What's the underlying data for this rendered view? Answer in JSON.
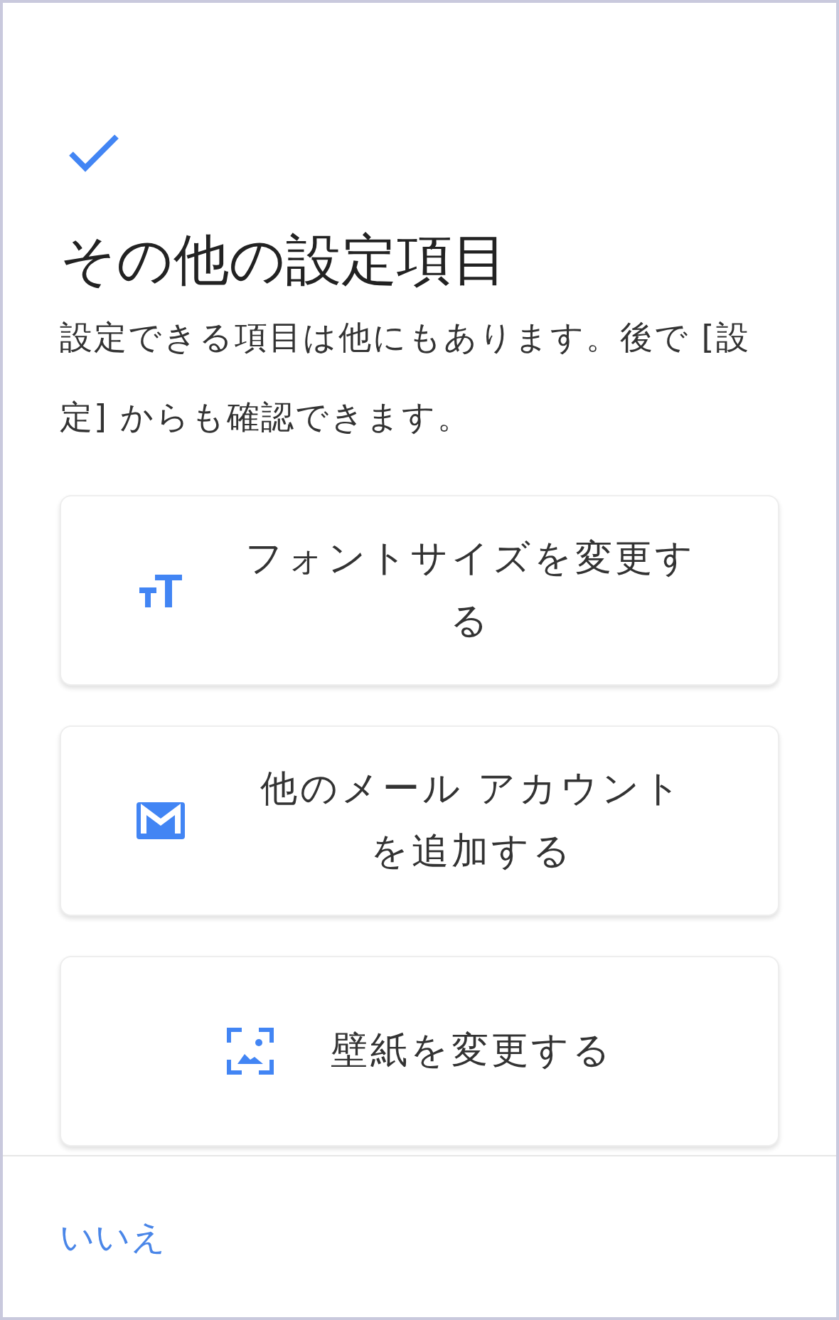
{
  "title": "その他の設定項目",
  "description": "設定できる項目は他にもあります。後で [設定] からも確認できます。",
  "options": [
    {
      "kind": "font",
      "label": "フォントサイズを変更する"
    },
    {
      "kind": "mail",
      "label": "他のメール アカウントを追加する"
    },
    {
      "kind": "wallpaper",
      "label": "壁紙を変更する"
    }
  ],
  "footer": {
    "button": "いいえ"
  }
}
